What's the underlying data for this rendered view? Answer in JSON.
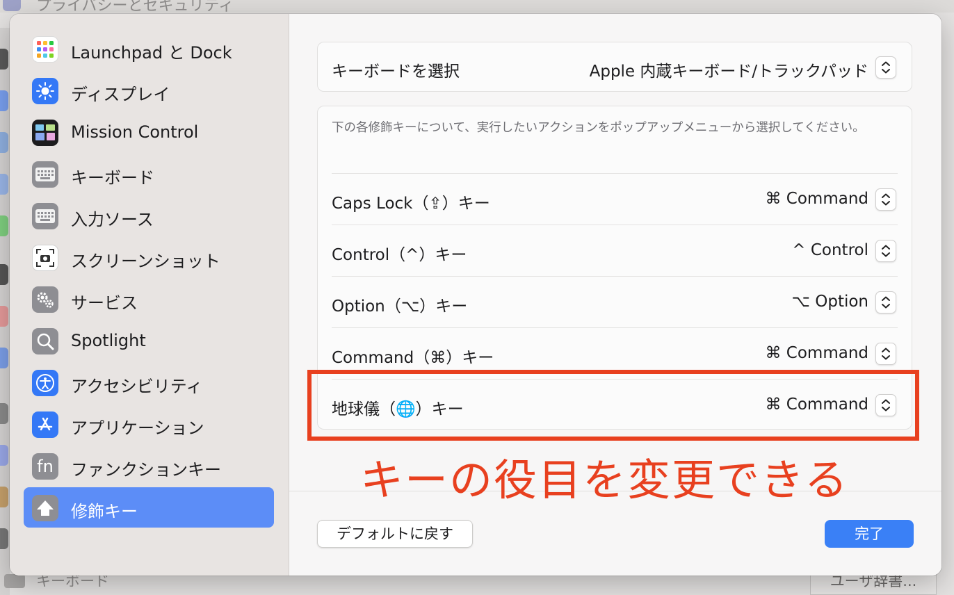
{
  "background": {
    "top_text": "プライバシーとセキュリティ",
    "bottom_text": "キーボード",
    "bottom_button": "ユーザ辞書..."
  },
  "sidebar": {
    "items": [
      {
        "label": "Launchpad と Dock",
        "icon": "launchpad-grid-icon"
      },
      {
        "label": "ディスプレイ",
        "icon": "sun-icon"
      },
      {
        "label": "Mission Control",
        "icon": "mission-control-icon"
      },
      {
        "label": "キーボード",
        "icon": "keyboard-icon"
      },
      {
        "label": "入力ソース",
        "icon": "keyboard-icon"
      },
      {
        "label": "スクリーンショット",
        "icon": "camera-icon"
      },
      {
        "label": "サービス",
        "icon": "gears-icon"
      },
      {
        "label": "Spotlight",
        "icon": "magnifier-icon"
      },
      {
        "label": "アクセシビリティ",
        "icon": "accessibility-icon"
      },
      {
        "label": "アプリケーション",
        "icon": "app-store-icon"
      },
      {
        "label": "ファンクションキー",
        "icon": "fn-icon"
      },
      {
        "label": "修飾キー",
        "icon": "shift-arrow-icon"
      }
    ],
    "selected_index": 11
  },
  "keyboard_select": {
    "label": "キーボードを選択",
    "value": "Apple 内蔵キーボード/トラックパッド"
  },
  "modifiers": {
    "description": "下の各修飾キーについて、実行したいアクションをポップアップメニューから選択してください。",
    "rows": [
      {
        "label": "Caps Lock（⇪）キー",
        "value": "⌘ Command"
      },
      {
        "label": "Control（^）キー",
        "value": "^ Control"
      },
      {
        "label": "Option（⌥）キー",
        "value": "⌥ Option"
      },
      {
        "label": "Command（⌘）キー",
        "value": "⌘ Command"
      },
      {
        "label": "地球儀（🌐）キー",
        "value": "⌘ Command"
      }
    ]
  },
  "footer": {
    "default_button": "デフォルトに戻す",
    "done_button": "完了"
  },
  "annotation": {
    "text": "キーの役目を変更できる",
    "color": "#e8401f"
  },
  "colors": {
    "accent": "#3a80f6",
    "selected_sidebar": "#5c8df7"
  }
}
